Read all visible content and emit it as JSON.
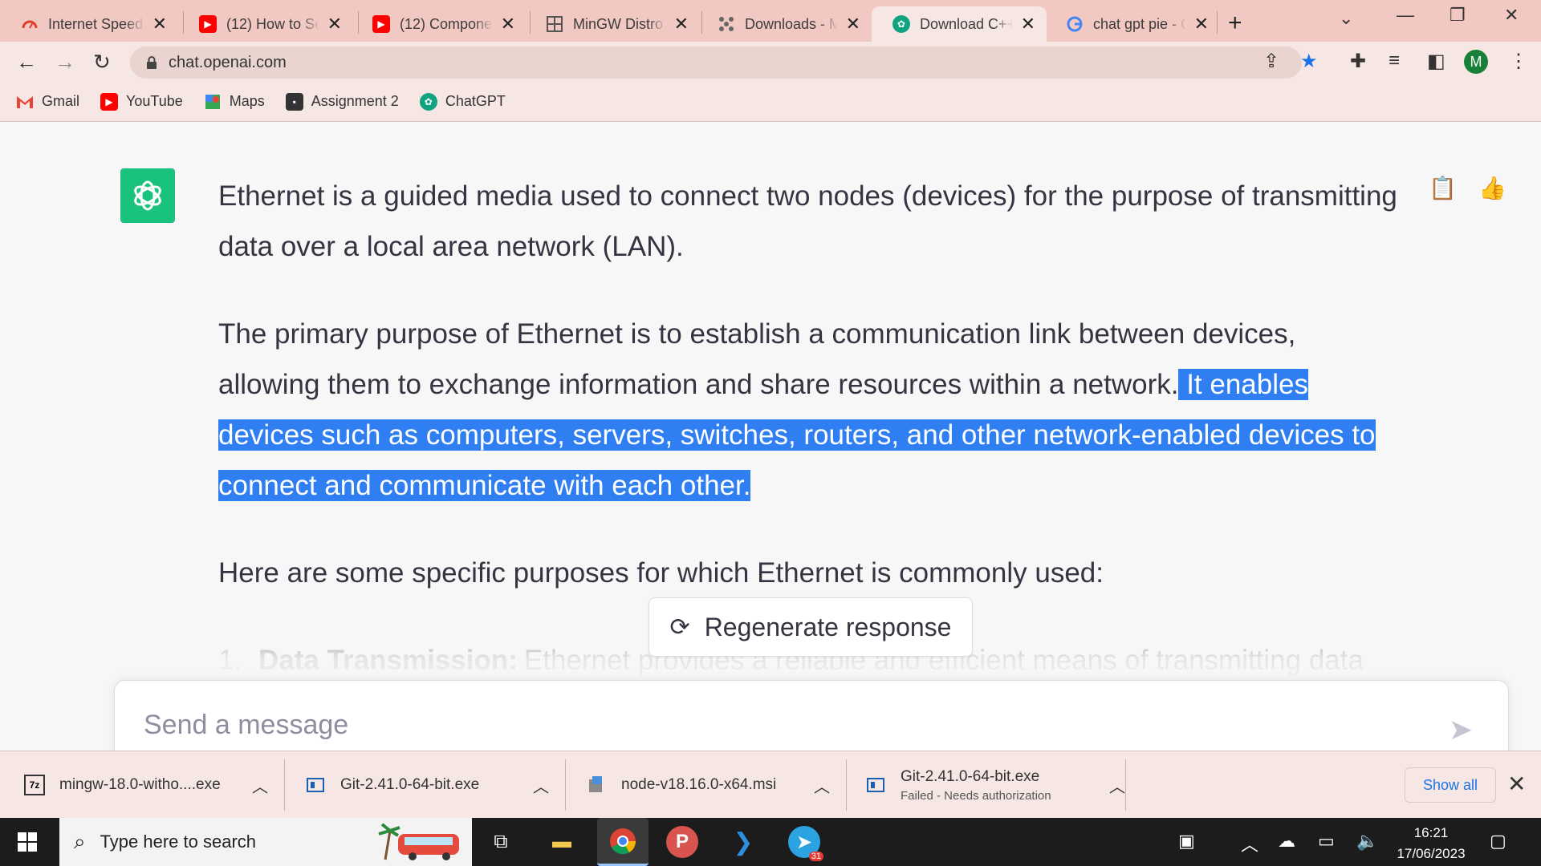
{
  "browser": {
    "tabs": [
      {
        "title": "Internet Speed",
        "icon": "speedtest-icon",
        "color": "#e03e2d"
      },
      {
        "title": "(12) How to Se",
        "icon": "youtube-icon",
        "color": "#ff0000"
      },
      {
        "title": "(12) Componen",
        "icon": "youtube-icon",
        "color": "#ff0000"
      },
      {
        "title": "MinGW Distro",
        "icon": "grid-icon",
        "color": "#555555"
      },
      {
        "title": "Downloads - M",
        "icon": "dots-icon",
        "color": "#555555"
      },
      {
        "title": "Download C++",
        "icon": "chatgpt-icon",
        "color": "#10a37f"
      },
      {
        "title": "chat gpt pie - G",
        "icon": "google-icon",
        "color": "#4285f4"
      }
    ],
    "url": "chat.openai.com",
    "bookmarks": [
      {
        "label": "Gmail",
        "icon": "gmail-icon"
      },
      {
        "label": "YouTube",
        "icon": "youtube-icon"
      },
      {
        "label": "Maps",
        "icon": "maps-icon"
      },
      {
        "label": "Assignment 2",
        "icon": "classroom-icon"
      },
      {
        "label": "ChatGPT",
        "icon": "chatgpt-icon"
      }
    ],
    "profile_initial": "M"
  },
  "chat": {
    "para1": "Ethernet is a guided media used to connect two nodes (devices) for the purpose of transmitting data over a local area network (LAN).",
    "para2_plain": "The primary purpose of Ethernet is to establish a communication link between devices, allowing them to exchange information and share resources within a network.",
    "para2_selected": " It enables devices such as computers, servers, switches, routers, and other network-enabled devices to connect and communicate with each other.",
    "para3": "Here are some specific purposes for which Ethernet is commonly used:",
    "list_item_number": "1.",
    "list_item_bold": "Data Transmission:",
    "list_item_text": "Ethernet provides a reliable and efficient means of transmitting data",
    "regenerate_label": "Regenerate response",
    "input_placeholder": "Send a message",
    "selection_color": "#2f7ff3",
    "accent_color": "#19c37d"
  },
  "downloads": {
    "items": [
      {
        "name": "mingw-18.0-witho....exe",
        "sub": ""
      },
      {
        "name": "Git-2.41.0-64-bit.exe",
        "sub": ""
      },
      {
        "name": "node-v18.16.0-x64.msi",
        "sub": ""
      },
      {
        "name": "Git-2.41.0-64-bit.exe",
        "sub": "Failed - Needs authorization"
      }
    ],
    "show_all": "Show all"
  },
  "taskbar": {
    "search_placeholder": "Type here to search",
    "telegram_badge": "31",
    "time": "16:21",
    "date": "17/06/2023"
  }
}
